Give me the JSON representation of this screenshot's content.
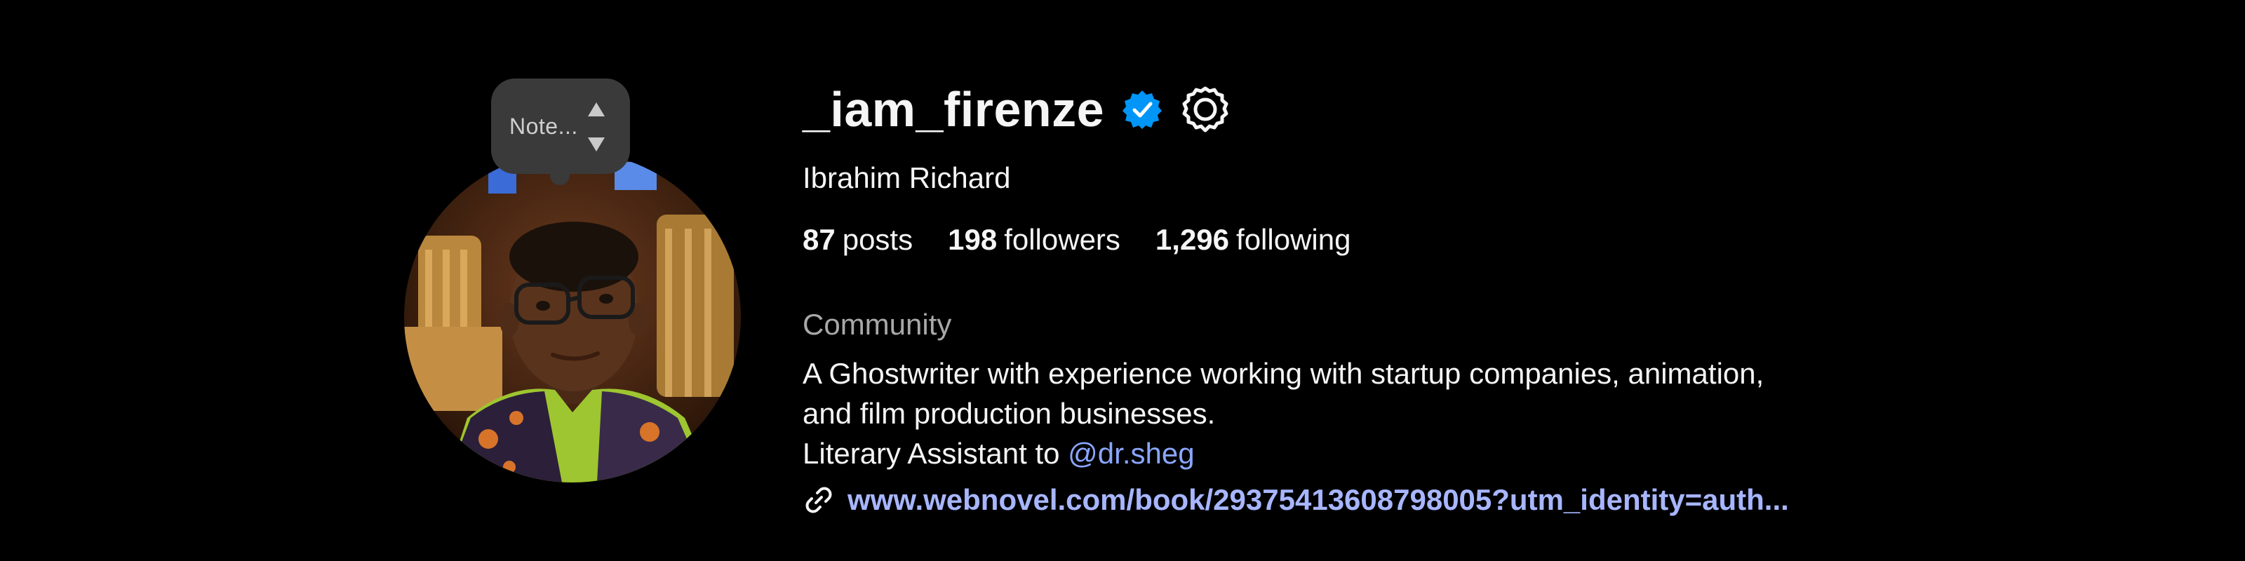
{
  "profile": {
    "username": "_iam_firenze",
    "full_name": "Ibrahim Richard",
    "note": "Note...",
    "stats": {
      "posts_count": "87",
      "posts_label": "posts",
      "followers_count": "198",
      "followers_label": "followers",
      "following_count": "1,296",
      "following_label": "following"
    },
    "category": "Community",
    "bio": {
      "line1": "A Ghostwriter with experience working with startup companies, animation,",
      "line2": "and film production businesses.",
      "line3_prefix": "Literary Assistant to ",
      "mention": "@dr.sheg"
    },
    "link": "www.webnovel.com/book/29375413608798005?utm_identity=auth..."
  },
  "icons": {
    "verified": "verified-badge-icon",
    "settings": "settings-gear-icon",
    "link": "link-chain-icon",
    "stepper_up": "triangle-up-icon",
    "stepper_down": "triangle-down-icon"
  },
  "colors": {
    "background": "#000000",
    "text": "#f5f5f5",
    "secondary": "#a8a8a8",
    "verified": "#0095f6",
    "link": "#a7b6ff",
    "mention": "#8aa6ff",
    "note_bubble": "#3a3a3a"
  }
}
